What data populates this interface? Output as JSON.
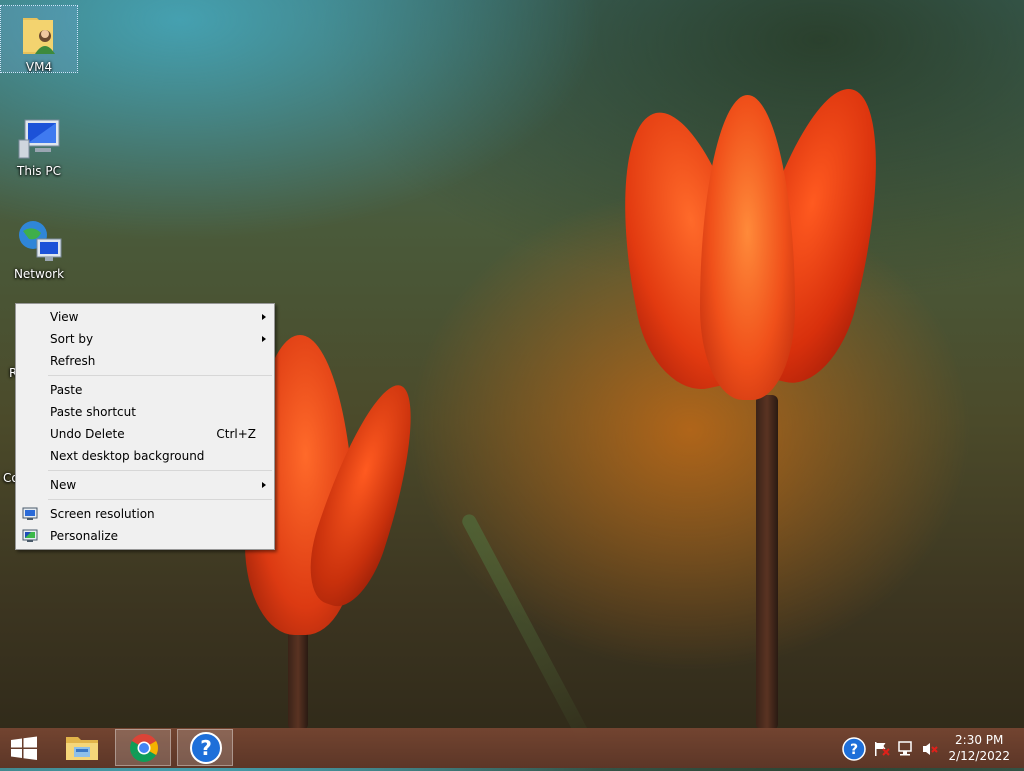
{
  "desktop_icons": [
    {
      "label": "VM4",
      "icon": "user-folder-icon",
      "selected": true
    },
    {
      "label": "This PC",
      "icon": "computer-icon"
    },
    {
      "label": "Network",
      "icon": "network-icon"
    },
    {
      "label": "R",
      "icon": "recycle-bin-icon"
    },
    {
      "label": "Co",
      "icon": "control-panel-icon"
    }
  ],
  "context_menu": {
    "items": [
      {
        "label": "View",
        "submenu": true
      },
      {
        "label": "Sort by",
        "submenu": true
      },
      {
        "label": "Refresh"
      },
      {
        "label": "Paste"
      },
      {
        "label": "Paste shortcut"
      },
      {
        "label": "Undo Delete",
        "shortcut": "Ctrl+Z"
      },
      {
        "label": "Next desktop background"
      },
      {
        "label": "New",
        "submenu": true
      },
      {
        "label": "Screen resolution",
        "icon": "screen-resolution-icon"
      },
      {
        "label": "Personalize",
        "icon": "personalize-icon"
      }
    ]
  },
  "taskbar": {
    "start_icon": "windows-logo-icon",
    "pinned": [
      {
        "name": "file-explorer",
        "icon": "folder-icon"
      },
      {
        "name": "chrome",
        "icon": "chrome-icon",
        "active": true
      },
      {
        "name": "help",
        "icon": "help-icon",
        "active": true
      }
    ],
    "tray_icons": [
      "help-icon",
      "action-center-flag-icon",
      "network-icon",
      "volume-muted-icon"
    ],
    "clock": {
      "time": "2:30 PM",
      "date": "2/12/2022"
    }
  },
  "colors": {
    "menu_bg": "#f0f0f0",
    "taskbar": "#6b4030",
    "accent_blue": "#1e6fd9"
  }
}
